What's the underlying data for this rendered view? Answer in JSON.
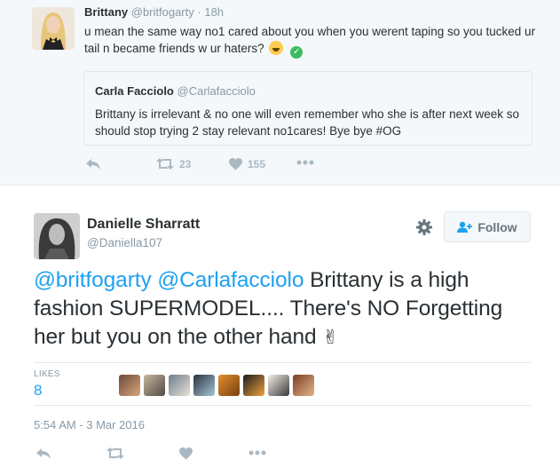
{
  "parent_tweet": {
    "name": "Brittany",
    "handle": "@britfogarty",
    "separator": "·",
    "time": "18h",
    "text": "u mean the same way no1 cared about you when you werent taping so you tucked ur tail n became friends w ur haters?",
    "quoted": {
      "name": "Carla Facciolo",
      "handle": "@Carlafacciolo",
      "text": "Brittany is irrelevant & no one will even remember who she is after next week so should stop trying 2 stay relevant no1cares! Bye bye #OG"
    },
    "retweet_count": "23",
    "like_count": "155"
  },
  "main_tweet": {
    "name": "Danielle Sharratt",
    "handle": "@Daniella107",
    "follow_label": "Follow",
    "mention1": "@britfogarty",
    "mention2": "@Carlafacciolo",
    "text": " Brittany is a high fashion SUPERMODEL.... There's NO Forgetting her but you on the other hand ",
    "emoji": "✌",
    "likes_label": "LIKES",
    "likes_count": "8",
    "timestamp": "5:54 AM - 3 Mar 2016"
  },
  "colors": {
    "accent": "#1da1f2",
    "muted": "#8899a6",
    "icon": "#aab8c2"
  }
}
